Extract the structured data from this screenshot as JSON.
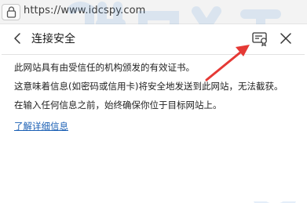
{
  "address_bar": {
    "url": "https://www.idcspy.com",
    "lock_icon": "lock-icon"
  },
  "panel": {
    "title": "连接安全",
    "back_icon": "chevron-left-icon",
    "certificate_icon": "certificate-icon",
    "close_icon": "close-icon",
    "paragraphs": [
      "此网站具有由受信任的机构颁发的有效证书。",
      "这意味着信息(如密码或信用卡)将安全地发送到此网站，无法截获。",
      "在输入任何信息之前，始终确保你位于目标网站上。"
    ],
    "learn_more_label": "了解详细信息"
  },
  "annotation": {
    "arrow_color": "#e53935"
  },
  "watermark": {
    "color": "#4a90d9"
  }
}
